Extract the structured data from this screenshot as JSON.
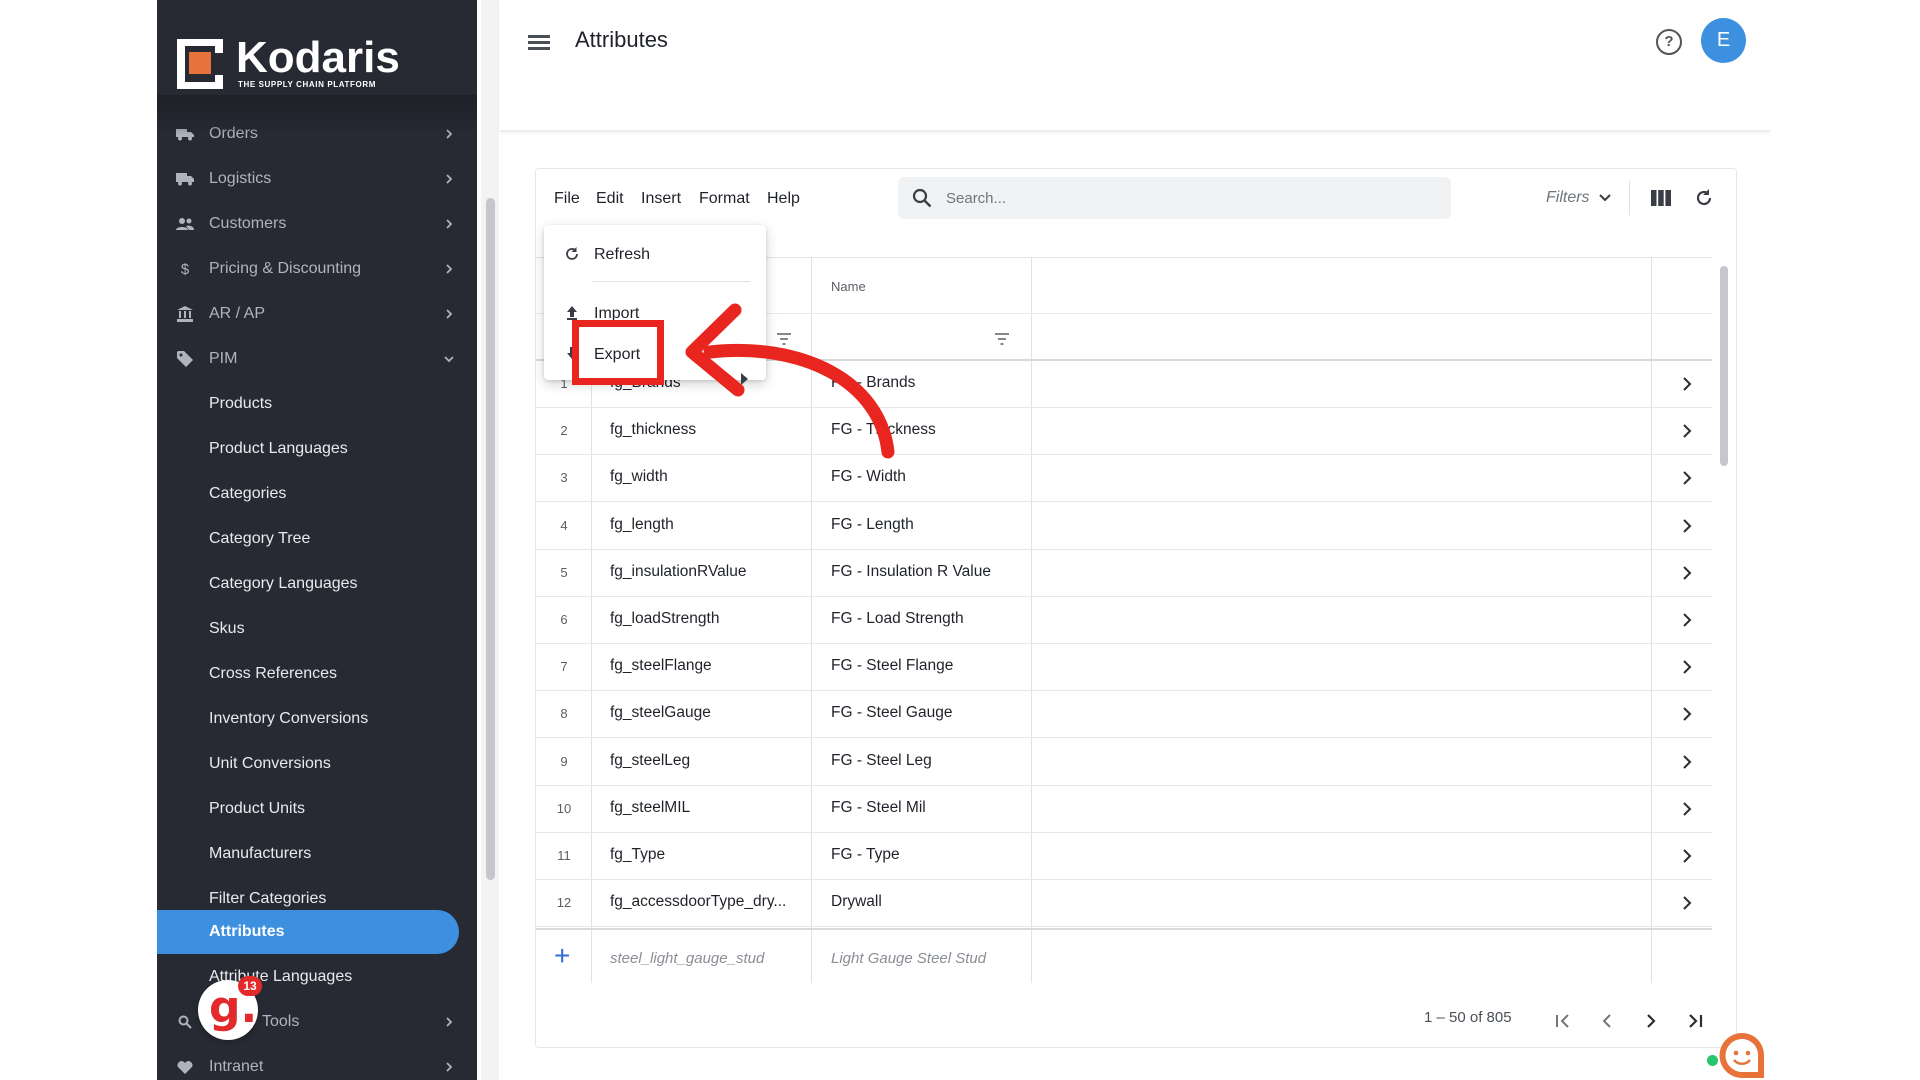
{
  "brand": {
    "name": "Kodaris",
    "tagline": "THE SUPPLY CHAIN PLATFORM",
    "accent": "#e8733a",
    "primary": "#3d8fe0"
  },
  "sidebar": {
    "items": [
      {
        "label": "Orders",
        "icon": "truck-icon"
      },
      {
        "label": "Logistics",
        "icon": "shipping-icon"
      },
      {
        "label": "Customers",
        "icon": "people-icon"
      },
      {
        "label": "Pricing & Discounting",
        "icon": "dollar-icon"
      },
      {
        "label": "AR / AP",
        "icon": "bank-icon"
      },
      {
        "label": "PIM",
        "icon": "tag-icon"
      }
    ],
    "pim_children": [
      "Products",
      "Product Languages",
      "Categories",
      "Category Tree",
      "Category Languages",
      "Skus",
      "Cross References",
      "Inventory Conversions",
      "Unit Conversions",
      "Product Units",
      "Manufacturers",
      "Filter Categories",
      "Attributes",
      "Attribute Languages"
    ],
    "active": "Attributes",
    "bottom_items": [
      {
        "label": "Tools",
        "icon": "search-icon"
      },
      {
        "label": "Intranet",
        "icon": "heart-icon"
      }
    ]
  },
  "header": {
    "title": "Attributes",
    "avatar_initial": "E"
  },
  "toolbar": {
    "menus": [
      "File",
      "Edit",
      "Insert",
      "Format",
      "Help"
    ],
    "search_placeholder": "Search...",
    "filters_label": "Filters"
  },
  "file_menu": {
    "refresh": "Refresh",
    "import": "Import",
    "export": "Export"
  },
  "table": {
    "columns": [
      "Name"
    ],
    "rows": [
      {
        "n": "1",
        "code": "fg_Brands",
        "name": "FG - Brands"
      },
      {
        "n": "2",
        "code": "fg_thickness",
        "name": "FG - Thickness"
      },
      {
        "n": "3",
        "code": "fg_width",
        "name": "FG - Width"
      },
      {
        "n": "4",
        "code": "fg_length",
        "name": "FG - Length"
      },
      {
        "n": "5",
        "code": "fg_insulationRValue",
        "name": "FG - Insulation R Value"
      },
      {
        "n": "6",
        "code": "fg_loadStrength",
        "name": "FG - Load Strength"
      },
      {
        "n": "7",
        "code": "fg_steelFlange",
        "name": "FG - Steel Flange"
      },
      {
        "n": "8",
        "code": "fg_steelGauge",
        "name": "FG - Steel Gauge"
      },
      {
        "n": "9",
        "code": "fg_steelLeg",
        "name": "FG - Steel Leg"
      },
      {
        "n": "10",
        "code": "fg_steelMIL",
        "name": "FG - Steel Mil"
      },
      {
        "n": "11",
        "code": "fg_Type",
        "name": "FG - Type"
      },
      {
        "n": "12",
        "code": "fg_accessdoorType_dry...",
        "name": "Drywall"
      }
    ],
    "new_row": {
      "code_placeholder": "steel_light_gauge_stud",
      "name_placeholder": "Light Gauge Steel Stud"
    }
  },
  "pager": {
    "range": "1 – 50 of 805"
  },
  "notifications": {
    "badge_count": "13"
  },
  "colors": {
    "sidebar_bg": "#272a33",
    "active_item": "#3d8fe0",
    "highlight": "#e8251f"
  }
}
